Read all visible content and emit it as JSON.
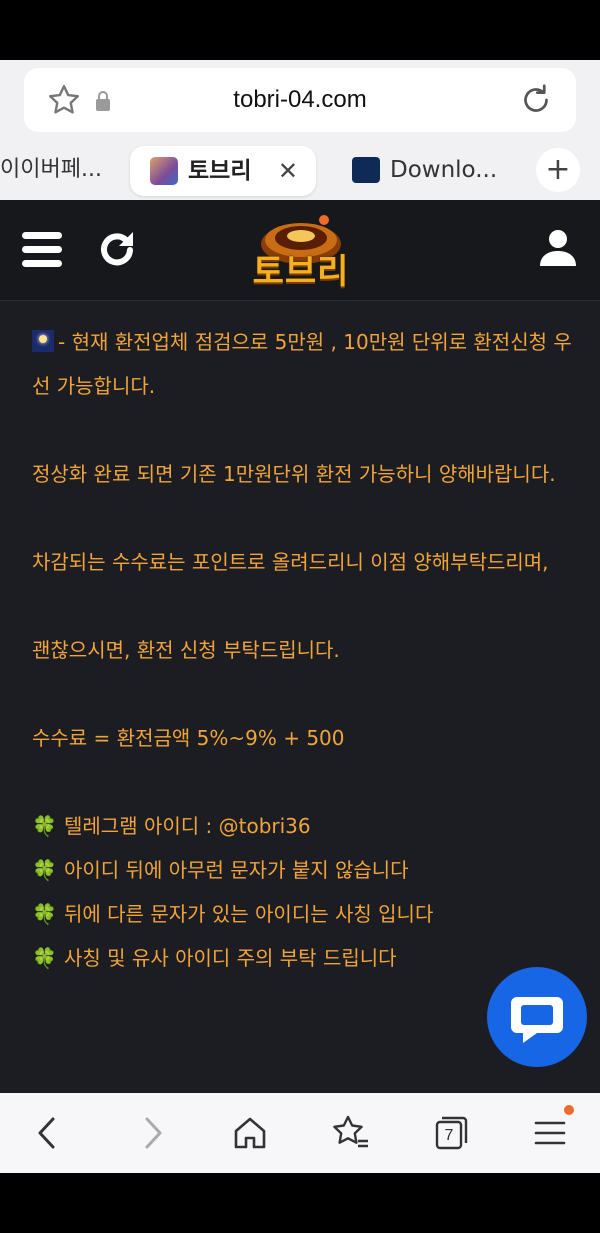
{
  "browser": {
    "url": "tobri-04.com",
    "tabs": [
      {
        "title": "이이버페...",
        "active": false
      },
      {
        "title": "토브리",
        "active": true
      },
      {
        "title": "Downlo...",
        "active": false
      }
    ],
    "close_glyph": "✕",
    "new_tab_glyph": "+",
    "tab_count": "7"
  },
  "site": {
    "logo_text": "토브리",
    "notice": {
      "line1": "- 현재 환전업체 점검으로 5만원 , 10만원 단위로 환전신청 우선 가능합니다.",
      "line2": "정상화 완료 되면 기존 1만원단위 환전 가능하니 양해바랍니다.",
      "line3": "차감되는 수수료는 포인트로 올려드리니 이점 양해부탁드리며,",
      "line4": "괜찮으시면, 환전 신청 부탁드립니다.",
      "line5": "수수료 = 환전금액 5%~9% + 500",
      "bullets": [
        "텔레그램 아이디 : @tobri36",
        "아이디 뒤에 아무런 문자가 붙지 않습니다",
        "뒤에 다른 문자가 있는 아이디는 사칭 입니다",
        "사칭 및 유사 아이디 주의 부탁 드립니다"
      ],
      "bullet_icon": "🍀"
    }
  },
  "colors": {
    "site_bg": "#1c1d22",
    "notice_text": "#f0a43a",
    "chat_button": "#1666e6",
    "logo_gold": "#f3b11d"
  },
  "icons": [
    "star-icon",
    "lock-icon",
    "reload-icon",
    "menu-icon",
    "refresh-icon",
    "user-icon",
    "chat-icon",
    "back-icon",
    "forward-icon",
    "home-icon",
    "bookmarks-icon",
    "tabs-icon",
    "menu-lines-icon"
  ]
}
